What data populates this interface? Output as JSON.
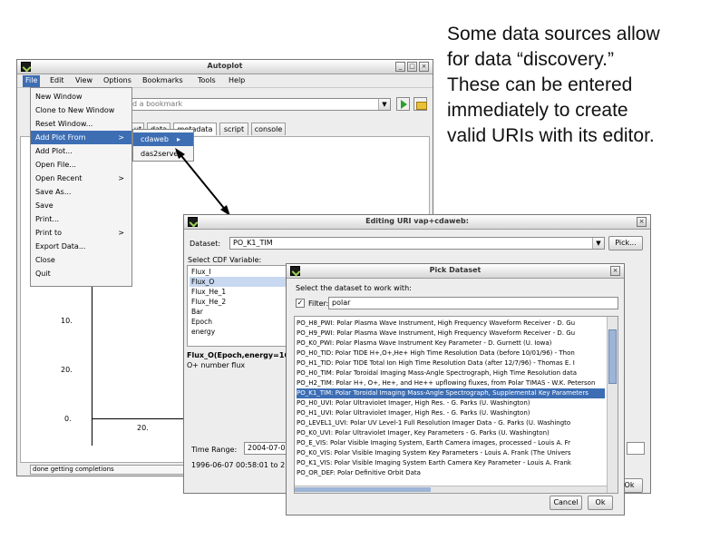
{
  "caption": {
    "lines": [
      "Some data sources allow",
      "for data “discovery.”",
      "These can be entered",
      "immediately to create",
      "valid URIs with its editor."
    ]
  },
  "autoplot": {
    "title": "Autoplot",
    "menus": [
      "File",
      "Edit",
      "View",
      "Options",
      "Bookmarks",
      "Tools",
      "Help"
    ],
    "address_placeholder": "d a bookmark",
    "tabs": [
      "ut",
      "data",
      "metadata",
      "script",
      "console"
    ],
    "y_ticks": [
      "10.",
      "20.",
      "0."
    ],
    "x_tick": "20.",
    "status": "done getting completions",
    "file_menu": [
      {
        "label": "New Window",
        "submenu": false
      },
      {
        "label": "Clone to New Window",
        "submenu": false
      },
      {
        "label": "Reset Window...",
        "submenu": false
      },
      {
        "label": "Add Plot From",
        "submenu": true
      },
      {
        "label": "Add Plot...",
        "submenu": false
      },
      {
        "label": "Open File...",
        "submenu": false
      },
      {
        "label": "Open Recent",
        "submenu": true
      },
      {
        "label": "Save As...",
        "submenu": false
      },
      {
        "label": "Save",
        "submenu": false
      },
      {
        "label": "Print...",
        "submenu": false
      },
      {
        "label": "Print to",
        "submenu": true
      },
      {
        "label": "Export Data...",
        "submenu": false
      },
      {
        "label": "Close",
        "submenu": false
      },
      {
        "label": "Quit",
        "submenu": false
      }
    ],
    "submenu": [
      "cdaweb",
      "das2server"
    ],
    "submenu_arrow": ">",
    "submenu_glyph": "▸"
  },
  "edit_dialog": {
    "title": "Editing URI vap+cdaweb:",
    "dataset_label": "Dataset:",
    "dataset_value": "PO_K1_TIM",
    "pick_label": "Pick...",
    "cdf_label": "Select CDF Variable:",
    "variables": [
      "Flux_I",
      "Flux_O",
      "Flux_He_1",
      "Flux_He_2",
      "Bar",
      "Epoch",
      "energy"
    ],
    "selected_variable": 1,
    "description_title": "Flux_O(Epoch,energy=16",
    "description_text": "O+ number flux",
    "time_range_label": "Time Range:",
    "time_range_value": "2004-07-0",
    "time_text": "1996-06-07 00:58:01 to 2",
    "ok_label": "Ok"
  },
  "pick_dialog": {
    "title": "Pick Dataset",
    "instructions": "Select the dataset to work with:",
    "filter_label": "Filter:",
    "filter_value": "polar",
    "cancel_label": "Cancel",
    "ok_label": "Ok",
    "selected_index": 7,
    "datasets": [
      "PO_H8_PWI: Polar Plasma Wave Instrument, High Frequency Waveform Receiver - D. Gu",
      "PO_H9_PWI: Polar Plasma Wave Instrument, High Frequency Waveform Receiver - D. Gu",
      "PO_K0_PWI: Polar Plasma Wave Instrument Key Parameter - D. Gurnett (U. Iowa)",
      "PO_H0_TID: Polar TIDE H+,O+,He+ High Time Resolution Data (before 10/01/96) - Thon",
      "PO_H1_TID: Polar TIDE Total Ion High Time Resolution Data (after 12/7/96) - Thomas E. I",
      "PO_H0_TIM: Polar Toroidal Imaging Mass-Angle Spectrograph, High Time Resolution data",
      "PO_H2_TIM: Polar H+, O+, He+, and He++ upflowing fluxes, from Polar TIMAS - W.K. Peterson",
      "PO_K1_TIM: Polar Toroidal Imaging Mass-Angle Spectrograph, Supplemental Key Parameters",
      "PO_H0_UVI: Polar Ultraviolet Imager, High Res. - G. Parks (U. Washington)",
      "PO_H1_UVI: Polar Ultraviolet Imager, High Res. - G. Parks (U. Washington)",
      "PO_LEVEL1_UVI: Polar UV Level-1 Full Resolution Imager Data - G. Parks (U. Washingto",
      "PO_K0_UVI: Polar Ultraviolet Imager, Key Parameters - G. Parks (U. Washington)",
      "PO_E_VIS: Polar Visible Imaging System, Earth Camera images, processed - Louis A. Fr",
      "PO_K0_VIS: Polar Visible Imaging System Key Parameters - Louis A. Frank (The Univers",
      "PO_K1_VIS: Polar Visible Imaging System Earth Camera Key Parameter - Louis A. Frank",
      "PO_OR_DEF: Polar Definitive Orbit Data"
    ]
  }
}
